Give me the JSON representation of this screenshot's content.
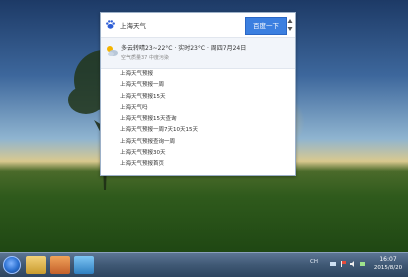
{
  "search": {
    "value": "上海天气",
    "button_label": "百度一下"
  },
  "weather": {
    "main_text": "多云转晴23~22°C · 实时23°C · 周四7月24日",
    "sub_text": "空气质量37 中度污染"
  },
  "suggestions": [
    "上海天气预报",
    "上海天气预报一周",
    "上海天气预报15天",
    "上海天气吗",
    "上海天气预报15天查询",
    "上海天气预报一周7天10天15天",
    "上海天气预报查询一周",
    "上海天气预报30天",
    "上海天气预报首页"
  ],
  "taskbar": {
    "language": "CH",
    "time": "16:07",
    "date": "2015/8/20"
  },
  "icons": {
    "logo": "baidu-paw-icon",
    "weather": "cloud-sun-icon",
    "start": "windows-start-icon"
  }
}
